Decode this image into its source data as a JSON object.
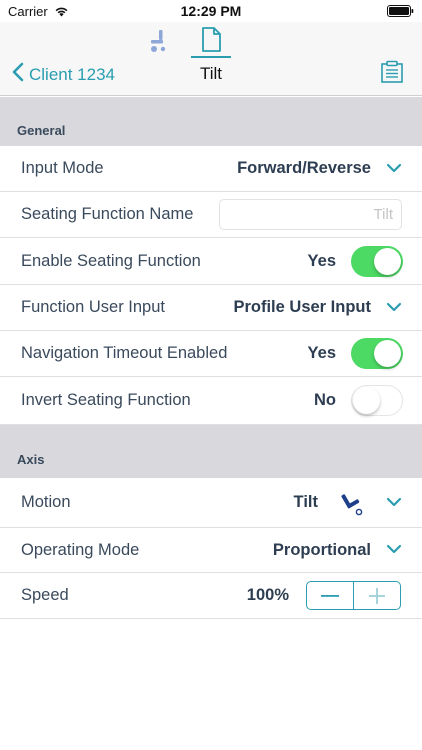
{
  "statusbar": {
    "carrier": "Carrier",
    "time": "12:29 PM"
  },
  "navbar": {
    "back_label": "Client 1234",
    "title": "Tilt"
  },
  "sections": {
    "general": "General",
    "axis": "Axis"
  },
  "general": {
    "input_mode": {
      "label": "Input Mode",
      "value": "Forward/Reverse"
    },
    "seating_function_name": {
      "label": "Seating Function Name",
      "placeholder": "Tilt"
    },
    "enable_seating_function": {
      "label": "Enable Seating Function",
      "value": "Yes",
      "on": true
    },
    "function_user_input": {
      "label": "Function User Input",
      "value": "Profile User Input"
    },
    "navigation_timeout": {
      "label": "Navigation Timeout Enabled",
      "value": "Yes",
      "on": true
    },
    "invert_seating_function": {
      "label": "Invert Seating Function",
      "value": "No",
      "on": false
    }
  },
  "axis": {
    "motion": {
      "label": "Motion",
      "value": "Tilt",
      "icon": "tilt-chair-icon"
    },
    "operating_mode": {
      "label": "Operating Mode",
      "value": "Proportional"
    },
    "speed": {
      "label": "Speed",
      "value": "100%"
    }
  },
  "colors": {
    "accent": "#2a9db0",
    "toggle_on": "#4cd964",
    "section_bg": "#d8d8dd",
    "text": "#3a4a5c"
  }
}
